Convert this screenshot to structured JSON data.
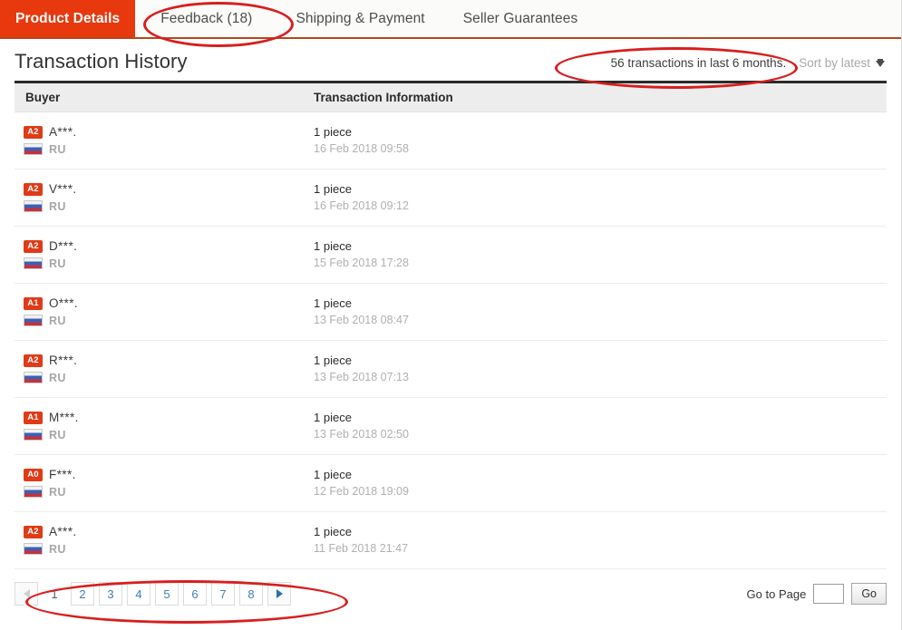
{
  "tabs": [
    {
      "label": "Product Details",
      "active": true
    },
    {
      "label": "Feedback (18)",
      "active": false
    },
    {
      "label": "Shipping & Payment",
      "active": false
    },
    {
      "label": "Seller Guarantees",
      "active": false
    }
  ],
  "header": {
    "title": "Transaction History",
    "transaction_count_text": "56 transactions in last 6 months.",
    "sort_label": "Sort by latest",
    "sort_icon": "chevron-down-icon"
  },
  "table": {
    "columns": [
      "Buyer",
      "Transaction Information"
    ],
    "rows": [
      {
        "badge": "A2",
        "buyer": "A***.",
        "flag_icon": "flag-ru-icon",
        "country": "RU",
        "quantity": "1 piece",
        "date": "16 Feb 2018 09:58"
      },
      {
        "badge": "A2",
        "buyer": "V***.",
        "flag_icon": "flag-ru-icon",
        "country": "RU",
        "quantity": "1 piece",
        "date": "16 Feb 2018 09:12"
      },
      {
        "badge": "A2",
        "buyer": "D***.",
        "flag_icon": "flag-ru-icon",
        "country": "RU",
        "quantity": "1 piece",
        "date": "15 Feb 2018 17:28"
      },
      {
        "badge": "A1",
        "buyer": "O***.",
        "flag_icon": "flag-ru-icon",
        "country": "RU",
        "quantity": "1 piece",
        "date": "13 Feb 2018 08:47"
      },
      {
        "badge": "A2",
        "buyer": "R***.",
        "flag_icon": "flag-ru-icon",
        "country": "RU",
        "quantity": "1 piece",
        "date": "13 Feb 2018 07:13"
      },
      {
        "badge": "A1",
        "buyer": "M***.",
        "flag_icon": "flag-ru-icon",
        "country": "RU",
        "quantity": "1 piece",
        "date": "13 Feb 2018 02:50"
      },
      {
        "badge": "A0",
        "buyer": "F***.",
        "flag_icon": "flag-ru-icon",
        "country": "RU",
        "quantity": "1 piece",
        "date": "12 Feb 2018 19:09"
      },
      {
        "badge": "A2",
        "buyer": "A***.",
        "flag_icon": "flag-ru-icon",
        "country": "RU",
        "quantity": "1 piece",
        "date": "11 Feb 2018 21:47"
      }
    ]
  },
  "pagination": {
    "prev_icon": "triangle-left-icon",
    "next_icon": "triangle-right-icon",
    "pages": [
      "1",
      "2",
      "3",
      "4",
      "5",
      "6",
      "7",
      "8"
    ],
    "current_page": "1",
    "goto_label": "Go to Page",
    "goto_value": "",
    "goto_placeholder": "",
    "go_button_label": "Go"
  },
  "colors": {
    "accent_red": "#e8380d",
    "badge_red": "#e03a16",
    "link_blue": "#3c7fb1",
    "annotation_red": "#d81e1e",
    "header_gray": "#ededed"
  }
}
